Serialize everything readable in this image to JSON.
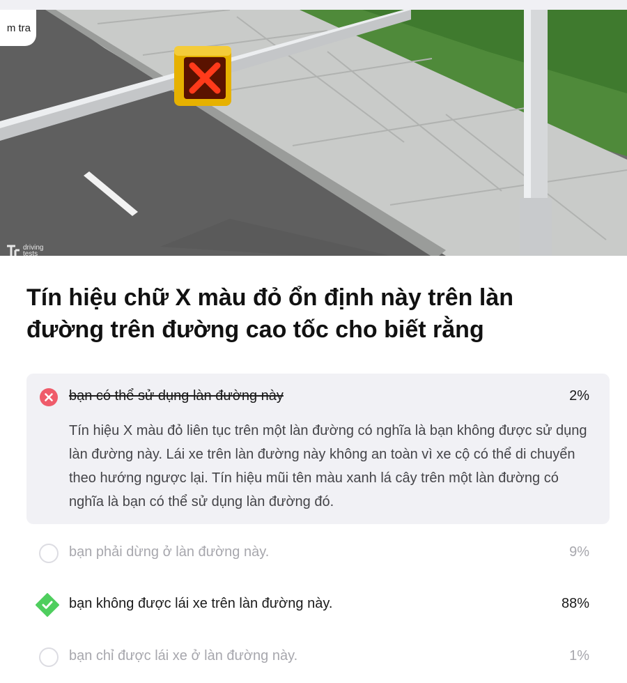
{
  "header": {
    "back_label": "m tra"
  },
  "hero": {
    "watermark_line1": "driving",
    "watermark_line2": "tests"
  },
  "question": {
    "text": "Tín hiệu chữ X màu đỏ ổn định này trên làn đường trên đường cao tốc cho biết rằng"
  },
  "answers": [
    {
      "text": "bạn có thể sử dụng làn đường này",
      "percent": "2%",
      "state": "selected-wrong",
      "explanation": "Tín hiệu X màu đỏ liên tục trên một làn đường có nghĩa là bạn không được sử dụng làn đường này. Lái xe trên làn đường này không an toàn vì xe cộ có thể di chuyển theo hướng ngược lại. Tín hiệu mũi tên màu xanh lá cây trên một làn đường có nghĩa là bạn có thể sử dụng làn đường đó."
    },
    {
      "text": "bạn phải dừng ở làn đường này.",
      "percent": "9%",
      "state": "unselected"
    },
    {
      "text": "bạn không được lái xe trên làn đường này.",
      "percent": "88%",
      "state": "correct"
    },
    {
      "text": "bạn chỉ được lái xe ở làn đường này.",
      "percent": "1%",
      "state": "unselected"
    }
  ],
  "colors": {
    "wrong": "#ef5b6a",
    "correct": "#4fce5e",
    "muted_text": "#a7a7ad",
    "explanation_bg": "#f1f1f5"
  },
  "icons": {
    "wrong": "x-circle-icon",
    "correct": "check-diamond-icon",
    "unselected": "empty-radio-icon"
  }
}
